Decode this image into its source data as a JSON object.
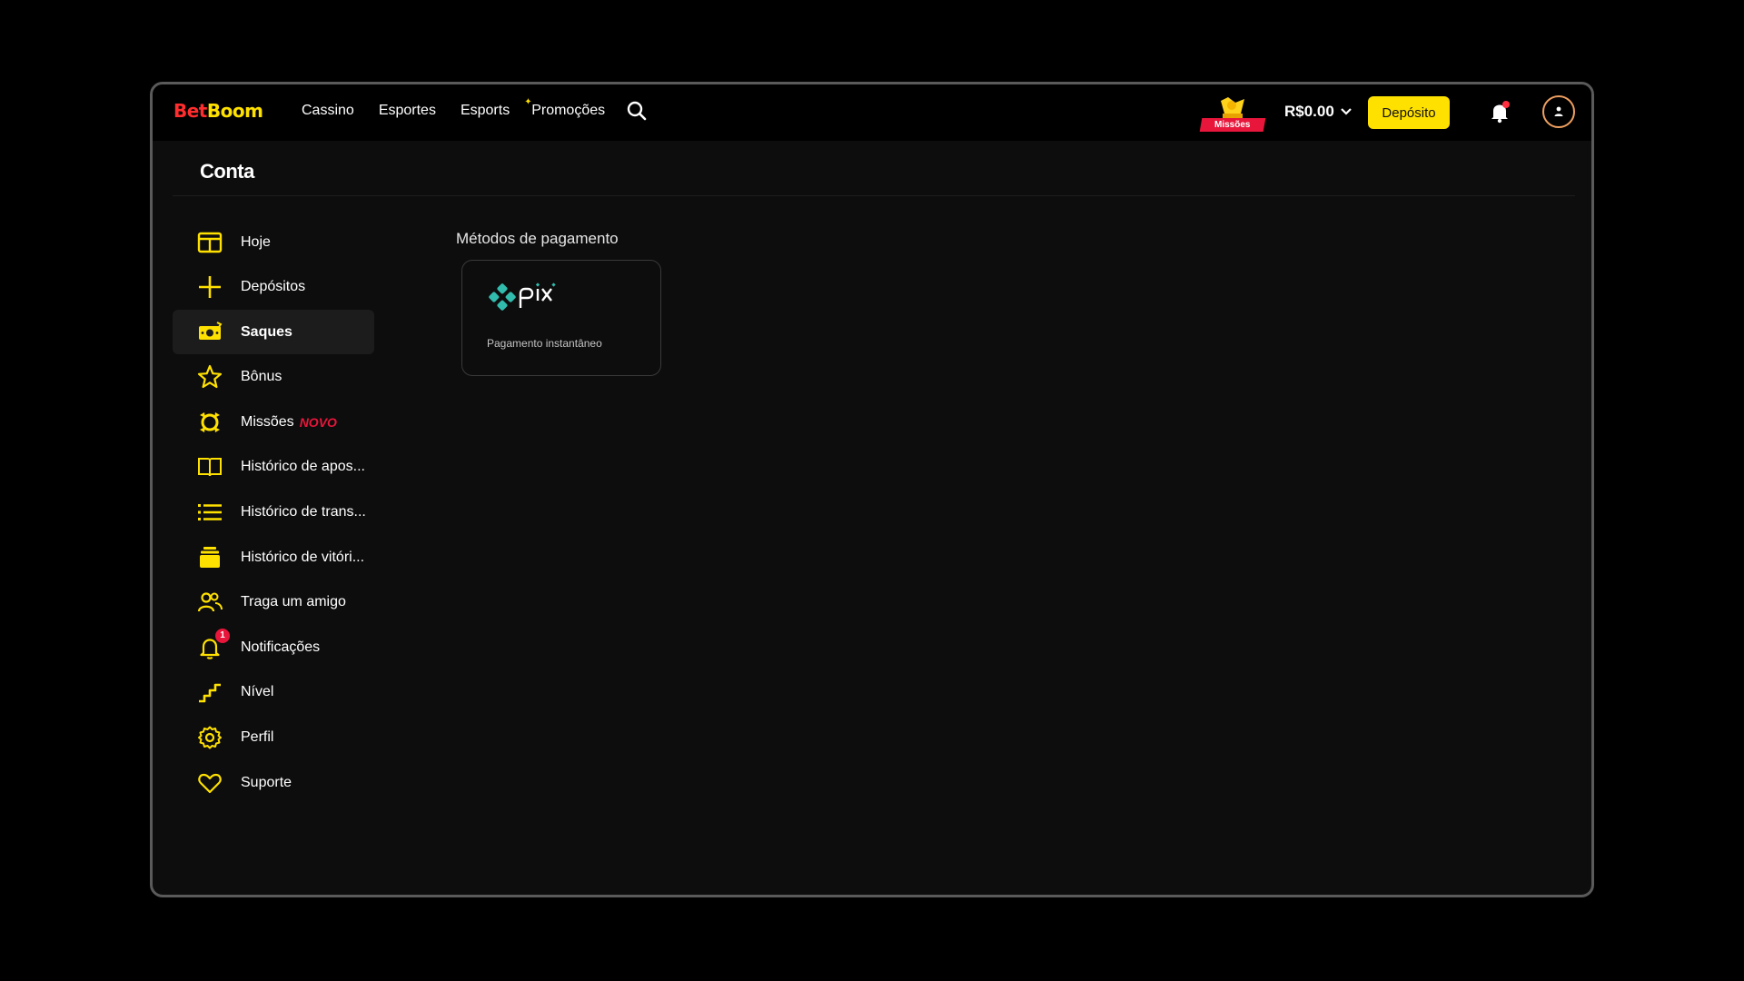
{
  "header": {
    "logo_part1": "Bet",
    "logo_part2": "Boom",
    "nav": [
      {
        "label": "Cassino"
      },
      {
        "label": "Esportes"
      },
      {
        "label": "Esports"
      },
      {
        "label": "Promoções"
      }
    ],
    "missions_label": "Missões",
    "balance": "R$0.00",
    "deposit_label": "Depósito",
    "notification_dot": true
  },
  "page": {
    "title": "Conta"
  },
  "sidebar": {
    "active_index": 2,
    "items": [
      {
        "label": "Hoje",
        "icon": "layout-columns-icon"
      },
      {
        "label": "Depósitos",
        "icon": "plus-icon"
      },
      {
        "label": "Saques",
        "icon": "money-icon"
      },
      {
        "label": "Bônus",
        "icon": "star-icon"
      },
      {
        "label": "Missões",
        "icon": "missions-icon",
        "tag": "NOVO"
      },
      {
        "label": "Histórico de apos...",
        "icon": "book-icon"
      },
      {
        "label": "Histórico de trans...",
        "icon": "list-icon"
      },
      {
        "label": "Histórico de vitóri...",
        "icon": "stack-icon"
      },
      {
        "label": "Traga um amigo",
        "icon": "users-icon"
      },
      {
        "label": "Notificações",
        "icon": "bell-icon",
        "badge": "1"
      },
      {
        "label": "Nível",
        "icon": "stairs-icon"
      },
      {
        "label": "Perfil",
        "icon": "gear-icon"
      },
      {
        "label": "Suporte",
        "icon": "heart-icon"
      }
    ]
  },
  "payment": {
    "section_title": "Métodos de pagamento",
    "methods": [
      {
        "name": "pix",
        "description": "Pagamento instantâneo"
      }
    ]
  },
  "colors": {
    "accent_yellow": "#ffe100",
    "brand_red": "#ff2d2d",
    "pix_teal": "#32bcad",
    "background": "#0d0d0d"
  }
}
